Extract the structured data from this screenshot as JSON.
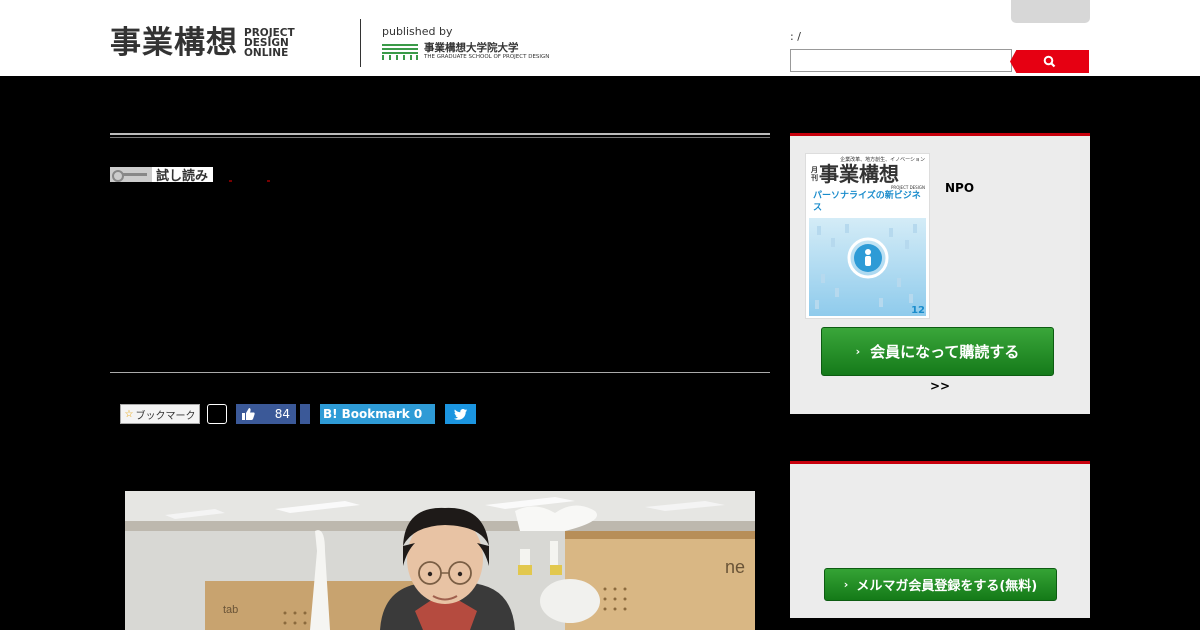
{
  "header": {
    "logo_kanji": "事業構想",
    "logo_en_1": "PROJECT",
    "logo_en_2": "DESIGN",
    "logo_en_3": "ONLINE",
    "published_by": "published by",
    "publisher_jp": "事業構想大学院大学",
    "publisher_en": "THE GRADUATE SCHOOL OF PROJECT DESIGN",
    "date_line": ":     /",
    "search": {
      "value": "",
      "placeholder": ""
    }
  },
  "article": {
    "trial_badge": "試し読み",
    "social": {
      "bookmark_label": "ブックマーク",
      "like_count": "84",
      "hatena_label": "Bookmark 0"
    },
    "photo_sign_1": "ne",
    "photo_sign_2": "tab"
  },
  "sidebar": {
    "magazine": {
      "top_line": "企業改革、地方創生、イノベーション",
      "issue_label": "月刊",
      "title": "事業構想",
      "title_sub": "PROJECT DESIGN",
      "feature": "パーソナライズの新ビジネス",
      "issue_number": "12"
    },
    "npo_label": "NPO",
    "subscribe_button": "会員になって購読する",
    "more_link": ">>",
    "newsletter_button": "メルマガ会員登録をする(無料)"
  },
  "colors": {
    "accent_red": "#e60012",
    "sidebar_red": "#c8000c",
    "button_green": "#157a1a",
    "facebook": "#3b5998",
    "hatena": "#2e9bd6",
    "twitter": "#1b95e0"
  },
  "icons": [
    "search-icon",
    "key-icon",
    "star-icon",
    "thumbs-up-icon",
    "hatena-b-icon",
    "twitter-bird-icon",
    "chevron-right-icon"
  ]
}
